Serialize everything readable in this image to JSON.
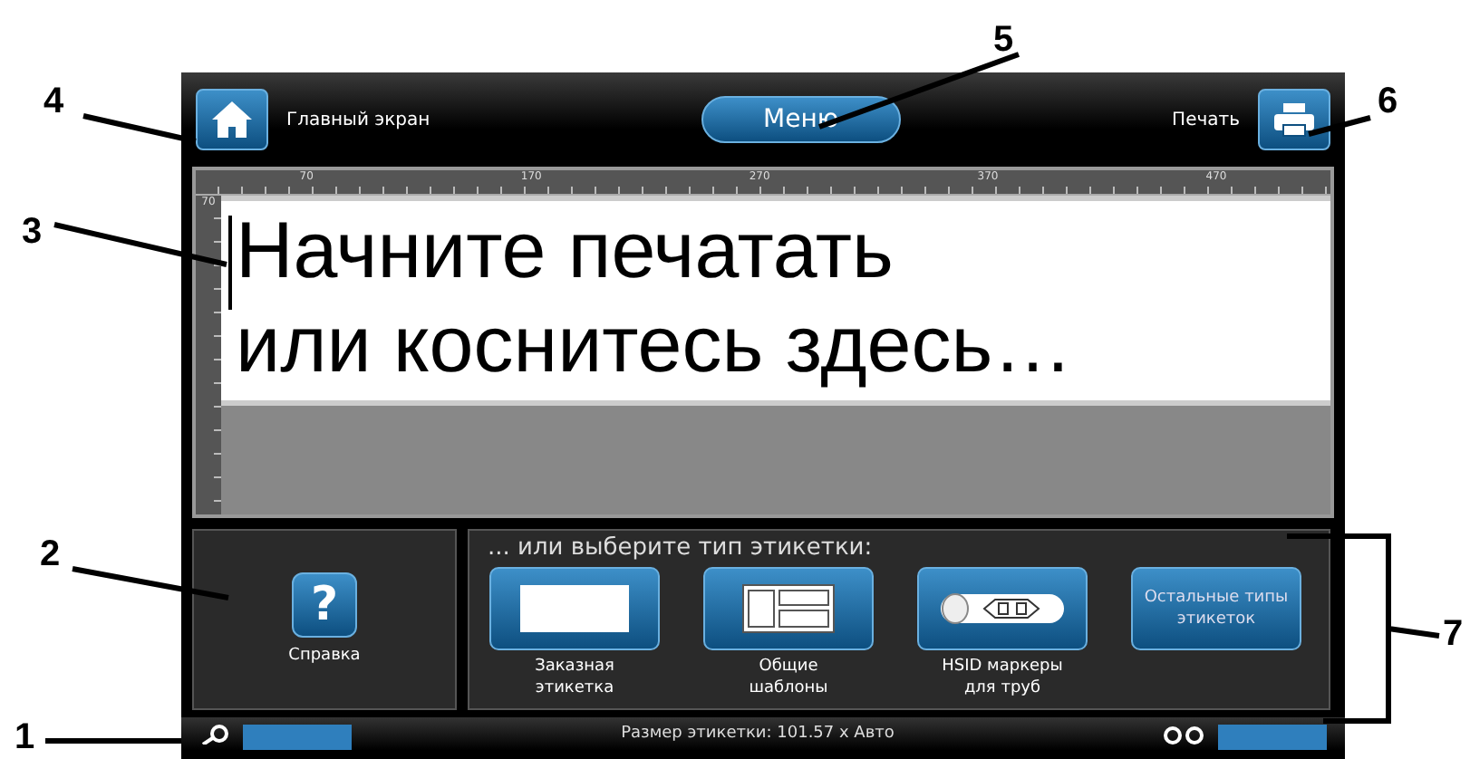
{
  "callouts": [
    "1",
    "2",
    "3",
    "4",
    "5",
    "6",
    "7"
  ],
  "top_bar": {
    "home_label": "Главный экран",
    "menu": "Меню",
    "print_label": "Печать"
  },
  "ruler": {
    "top_ticks": [
      "70",
      "170",
      "270",
      "370",
      "470"
    ],
    "left_ticks": [
      "70"
    ]
  },
  "editor": {
    "lines": [
      "Начните печатать",
      "или коснитесь здесь…"
    ]
  },
  "help": {
    "icon_text": "?",
    "label": "Справка"
  },
  "label_types": {
    "heading": "... или выберите тип этикетки:",
    "tiles": [
      {
        "kind": "blank",
        "caption": "Заказная этикетка"
      },
      {
        "kind": "templates",
        "caption": "Общие шаблоны"
      },
      {
        "kind": "pipe",
        "caption": "HSID маркеры для труб"
      },
      {
        "kind": "text",
        "label": "Остальные типы этикеток"
      }
    ]
  },
  "status_bar": {
    "text": "Размер этикетки: 101.57 x Авто"
  }
}
